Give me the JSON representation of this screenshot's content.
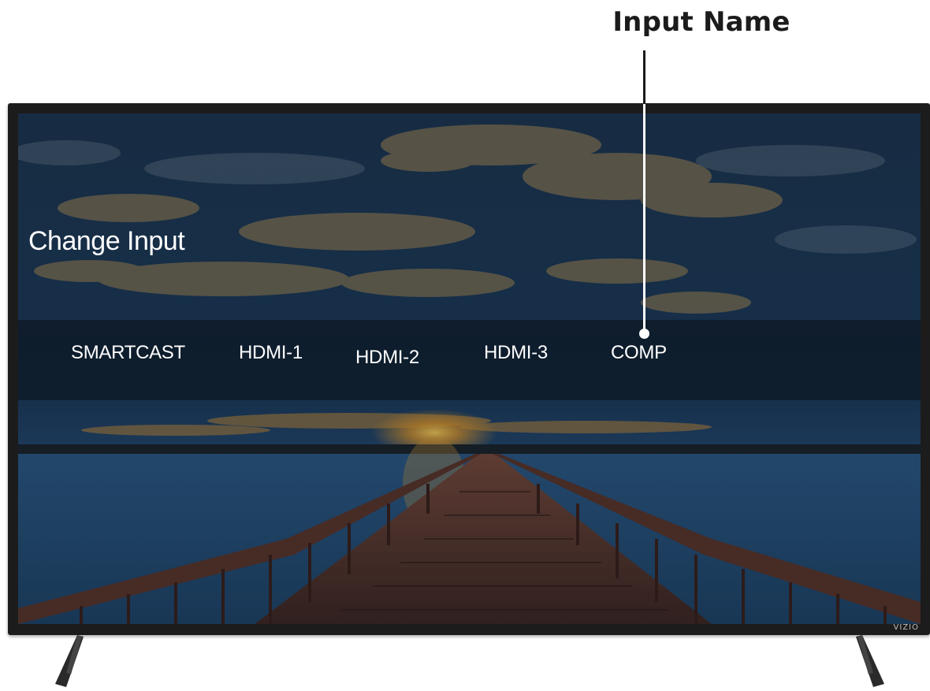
{
  "callout": {
    "label": "Input Name"
  },
  "menu": {
    "heading": "Change Input",
    "inputs": [
      {
        "label": "SMARTCAST"
      },
      {
        "label": "HDMI-1"
      },
      {
        "label": "HDMI-2"
      },
      {
        "label": "HDMI-3"
      },
      {
        "label": "COMP"
      }
    ]
  },
  "tv": {
    "brand": "VIZIO"
  },
  "colors": {
    "menu_text": "#ffffff",
    "input_bar": "#0c1822",
    "bezel": "#1c1c1c",
    "callout_text": "#1b1b1b"
  }
}
